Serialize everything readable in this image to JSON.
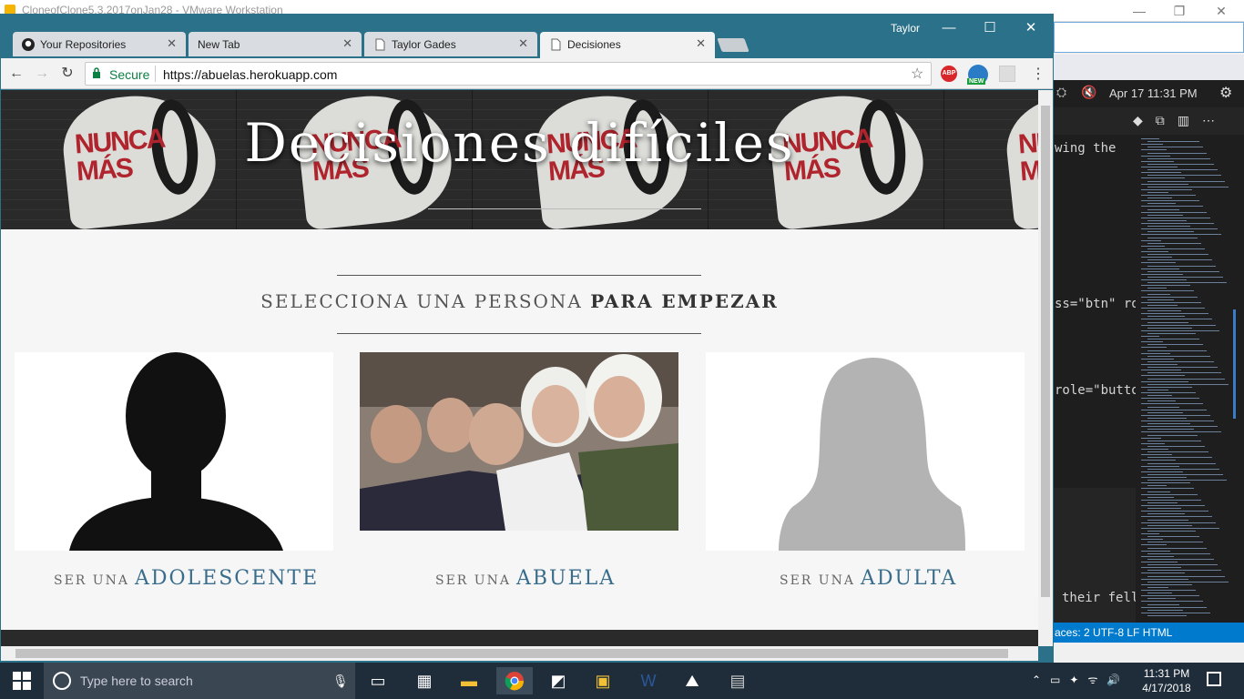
{
  "vmware": {
    "title": "CloneofClone5.3.2017onJan28 - VMware Workstation"
  },
  "editor": {
    "datetime": "Apr 17 11:31 PM",
    "code_lines": [
      "wing the",
      "ss=\"btn\" ro",
      "role=\"butto",
      "their fell"
    ],
    "status": "aces: 2   UTF-8   LF   HTML"
  },
  "chrome": {
    "profile": "Taylor",
    "tabs": [
      {
        "label": "Your Repositories",
        "icon": "github-icon"
      },
      {
        "label": "New Tab",
        "icon": ""
      },
      {
        "label": "Taylor Gades",
        "icon": "page-icon"
      },
      {
        "label": "Decisiones",
        "icon": "page-icon"
      }
    ],
    "secure_label": "Secure",
    "url": "https://abuelas.herokuapp.com",
    "ext_abp": "ABP",
    "ext_new": "NEW"
  },
  "page": {
    "hero_title": "Decisiones difíciles",
    "mural_text_1": "NUNCA",
    "mural_text_2": "MÁS",
    "prompt_light": "SELECCIONA UNA PERSONA",
    "prompt_bold": "PARA EMPEZAR",
    "cards": [
      {
        "prefix": "SER UNA",
        "name": "ADOLESCENTE"
      },
      {
        "prefix": "SER UNA",
        "name": "ABUELA"
      },
      {
        "prefix": "SER UNA",
        "name": "ADULTA"
      }
    ]
  },
  "taskbar": {
    "search_placeholder": "Type here to search",
    "time": "11:31 PM",
    "date": "4/17/2018"
  },
  "colors": {
    "accent": "#3a6d8c",
    "chrome_frame": "#2b7189",
    "mural_red": "#b0242d"
  }
}
